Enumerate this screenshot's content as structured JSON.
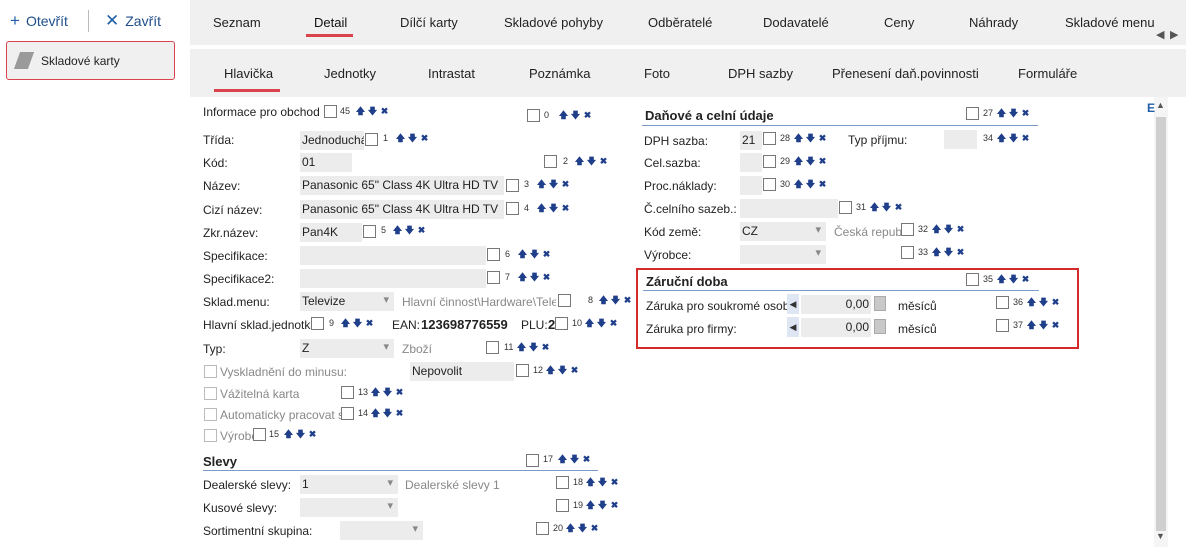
{
  "toolbar": {
    "open_label": "Otevřít",
    "close_label": "Zavřít"
  },
  "nav": {
    "card_label": "Skladové karty"
  },
  "main_tabs": [
    "Seznam",
    "Detail",
    "Dílčí karty",
    "Skladové pohyby",
    "Odběratelé",
    "Dodavatelé",
    "Ceny",
    "Náhrady",
    "Skladové menu"
  ],
  "sub_tabs": [
    "Hlavička",
    "Jednotky",
    "Intrastat",
    "Poznámka",
    "Foto",
    "DPH sazby",
    "Přenesení daň.povinnosti",
    "Formuláře"
  ],
  "left": {
    "info": {
      "label": "Informace pro obchod",
      "n": "45",
      "n2": "0"
    },
    "trida": {
      "label": "Třída:",
      "value": "Jednoduchá",
      "n": "1"
    },
    "kod": {
      "label": "Kód:",
      "value": "01",
      "n": "2"
    },
    "nazev": {
      "label": "Název:",
      "value": "Panasonic 65\" Class 4K Ultra HD TV",
      "n": "3"
    },
    "cizi": {
      "label": "Cizí název:",
      "value": "Panasonic 65\" Class 4K Ultra HD TV",
      "n": "4"
    },
    "zkr": {
      "label": "Zkr.název:",
      "value": "Pan4K",
      "n": "5"
    },
    "spec": {
      "label": "Specifikace:",
      "value": "",
      "n": "6"
    },
    "spec2": {
      "label": "Specifikace2:",
      "value": "",
      "n": "7"
    },
    "sklad": {
      "label": "Sklad.menu:",
      "value": "Televize",
      "extra": "Hlavní činnost\\Hardware\\Televiz",
      "n": "8"
    },
    "hlavni": {
      "label": "Hlavní sklad.jednotka:",
      "n": "9",
      "ean_label": "EAN:",
      "ean_value": "123698776559",
      "plu_label": "PLU:",
      "plu_value": "2",
      "n2": "10"
    },
    "typ": {
      "label": "Typ:",
      "value": "Z",
      "extra": "Zboží",
      "n": "11"
    },
    "vysklad": {
      "label": "Vyskladnění do minusu:",
      "value": "Nepovolit",
      "n": "12"
    },
    "vazitelna": {
      "label": "Vážitelná karta",
      "n": "13"
    },
    "auto": {
      "label": "Automaticky pracovat s d",
      "n": "14"
    },
    "vyrobek": {
      "label": "Výrobe",
      "n": "15"
    },
    "slevy": {
      "title": "Slevy",
      "n": "17"
    },
    "dealer": {
      "label": "Dealerské slevy:",
      "value": "1",
      "extra": "Dealerské slevy 1",
      "n": "18"
    },
    "kusove": {
      "label": "Kusové slevy:",
      "value": "",
      "n": "19"
    },
    "sortiment": {
      "label": "Sortimentní skupina:",
      "value": "",
      "n": "20"
    }
  },
  "right": {
    "dan": {
      "title": "Daňové a celní údaje",
      "n": "27"
    },
    "dph": {
      "label": "DPH sazba:",
      "value": "21",
      "n": "28",
      "typ_label": "Typ příjmu:",
      "n2": "34"
    },
    "cel": {
      "label": "Cel.sazba:",
      "n": "29"
    },
    "proc": {
      "label": "Proc.náklady:",
      "n": "30"
    },
    "celni": {
      "label": "Č.celního sazeb.:",
      "n": "31"
    },
    "zeme": {
      "label": "Kód země:",
      "value": "CZ",
      "extra": "Česká republik",
      "n": "32"
    },
    "vyrobce": {
      "label": "Výrobce:",
      "n": "33"
    },
    "zaruka": {
      "title": "Záruční doba",
      "n": "35"
    },
    "soukrome": {
      "label": "Záruka pro soukromé osoby:",
      "value": "0,00",
      "unit": "měsíců",
      "n": "36"
    },
    "firmy": {
      "label": "Záruka pro firmy:",
      "value": "0,00",
      "unit": "měsíců",
      "n": "37"
    }
  },
  "icons": {
    "open": "plus-icon",
    "close": "x-icon",
    "card": "card-icon",
    "up": "arrow-up-icon",
    "down": "arrow-down-icon",
    "remove": "remove-icon",
    "calc": "calculator-icon"
  }
}
